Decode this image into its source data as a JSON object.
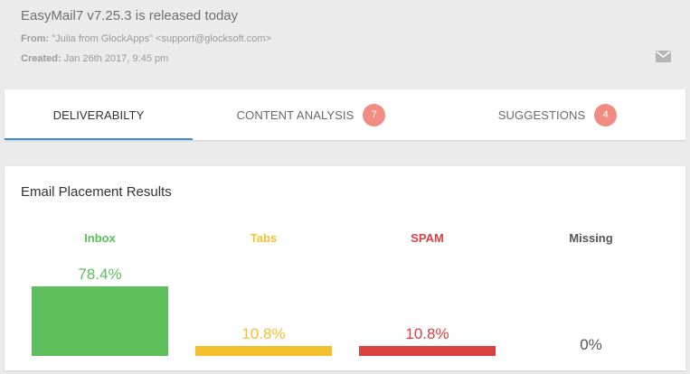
{
  "email": {
    "subject": "EasyMail7 v7.25.3 is released today",
    "from_label": "From:",
    "from_value": "\"Julia from GlockApps\" <support@glocksoft.com>",
    "created_label": "Created:",
    "created_value": "Jan 26th 2017, 9:45 pm",
    "icon": "envelope-icon"
  },
  "tabs": [
    {
      "label": "DELIVERABILTY",
      "active": true
    },
    {
      "label": "CONTENT ANALYSIS",
      "badge": "7"
    },
    {
      "label": "SUGGESTIONS",
      "badge": "4"
    }
  ],
  "placement": {
    "title": "Email Placement Results",
    "columns": [
      {
        "key": "inbox",
        "label": "Inbox",
        "percent_text": "78.4%",
        "value": 78.4,
        "color": "#5cbf5c",
        "label_color": "#5cbf5c"
      },
      {
        "key": "tabs",
        "label": "Tabs",
        "percent_text": "10.8%",
        "value": 10.8,
        "color": "#f4c02e",
        "label_color": "#f4c02e"
      },
      {
        "key": "spam",
        "label": "SPAM",
        "percent_text": "10.8%",
        "value": 10.8,
        "color": "#d94141",
        "label_color": "#d94141"
      },
      {
        "key": "missing",
        "label": "Missing",
        "percent_text": "0%",
        "value": 0,
        "color": "#555555",
        "label_color": "#555555"
      }
    ]
  }
}
